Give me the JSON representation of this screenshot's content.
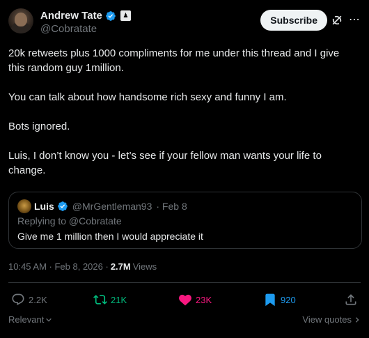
{
  "author": {
    "name": "Andrew Tate",
    "handle": "@Cobratate",
    "affiliate_badge": "♟"
  },
  "header": {
    "subscribe_label": "Subscribe",
    "more_label": "⋯"
  },
  "tweet": {
    "paragraphs": [
      "20k retweets plus 1000 compliments for me under this thread and I give this random guy 1million.",
      "You can talk about how handsome rich sexy and funny I am.",
      "Bots ignored.",
      "Luis, I don’t know you - let’s see if your fellow man wants your life to change."
    ]
  },
  "quote": {
    "name": "Luis",
    "handle": "@MrGentleman93",
    "date": "· Feb 8",
    "replying_to": "Replying to @Cobratate",
    "text": "Give me 1  million then I would appreciate it"
  },
  "meta": {
    "timestamp": "10:45 AM · Feb 8, 2026 ·",
    "views_count": "2.7M",
    "views_label": "Views"
  },
  "actions": {
    "replies": "2.2K",
    "retweets": "21K",
    "likes": "23K",
    "bookmarks": "920"
  },
  "footer": {
    "sort_label": "Relevant",
    "view_quotes_label": "View quotes"
  },
  "colors": {
    "verified": "#1d9bf0",
    "retweet": "#00ba7c",
    "like": "#f91880",
    "bookmark": "#1d9bf0"
  }
}
